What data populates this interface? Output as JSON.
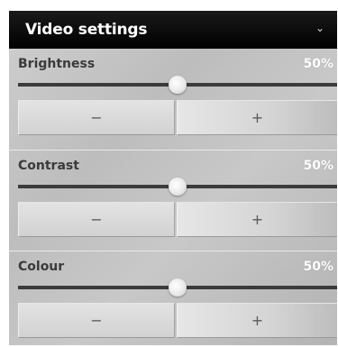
{
  "header": {
    "title": "Video settings",
    "toggle_icon": "chevron-down-icon",
    "toggle_glyph": "⌄"
  },
  "settings": [
    {
      "label": "Brightness",
      "value_text": "50%",
      "level": 0.5,
      "minus": "−",
      "plus": "+"
    },
    {
      "label": "Contrast",
      "value_text": "50%",
      "level": 0.5,
      "minus": "−",
      "plus": "+"
    },
    {
      "label": "Colour",
      "value_text": "50%",
      "level": 0.5,
      "minus": "−",
      "plus": "+"
    }
  ],
  "colors": {
    "header_bg": "#000000",
    "panel_bg": "#c4c4c4",
    "track": "#3b3b3b",
    "value_text": "#ffffff"
  }
}
